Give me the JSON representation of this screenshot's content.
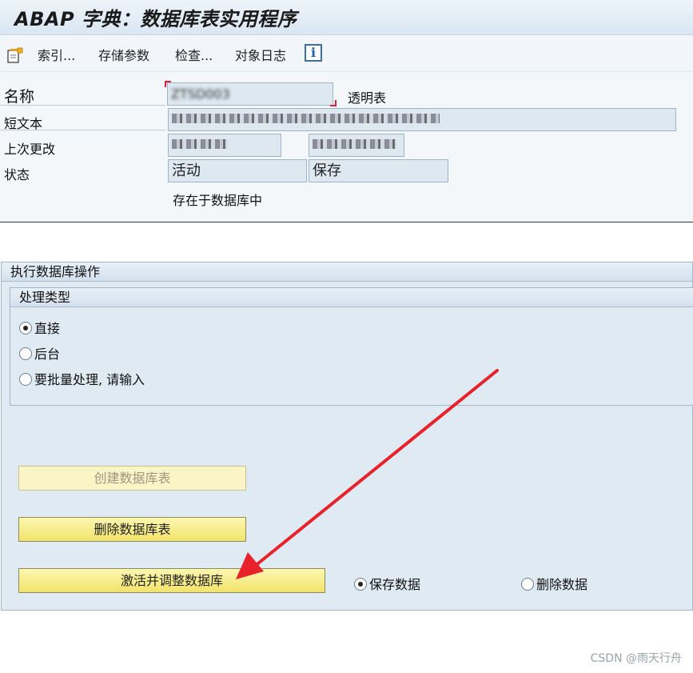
{
  "window": {
    "title": "ABAP 字典：数据库表实用程序"
  },
  "toolbar": {
    "new_icon": "document-new-icon",
    "buttons": [
      "索引...",
      "存储参数",
      "检查...",
      "对象日志"
    ],
    "info_icon": "info-icon",
    "info_label": "i"
  },
  "header": {
    "name_label": "名称",
    "name_value": "ZTSD003",
    "table_type": "透明表",
    "short_text_label": "短文本",
    "short_text_value": "",
    "last_change_label": "上次更改",
    "last_change_user": "",
    "last_change_date": "",
    "status_label": "状态",
    "status_active": "活动",
    "status_saved": "保存",
    "db_note": "存在于数据库中"
  },
  "db_ops": {
    "group_title": "执行数据库操作",
    "proc_type_title": "处理类型",
    "options": [
      {
        "label": "直接",
        "selected": true
      },
      {
        "label": "后台",
        "selected": false
      },
      {
        "label": "要批量处理, 请输入",
        "selected": false
      }
    ],
    "create_button": "创建数据库表",
    "delete_button": "删除数据库表",
    "activate_button": "激活并调整数据库",
    "save_data_label": "保存数据",
    "delete_data_label": "删除数据",
    "save_data_selected": true
  },
  "watermark": "CSDN @雨天行舟",
  "colors": {
    "sap_button": "#f1e36a",
    "group_bg": "#dfeaf3",
    "arrow": "#e8212b"
  }
}
